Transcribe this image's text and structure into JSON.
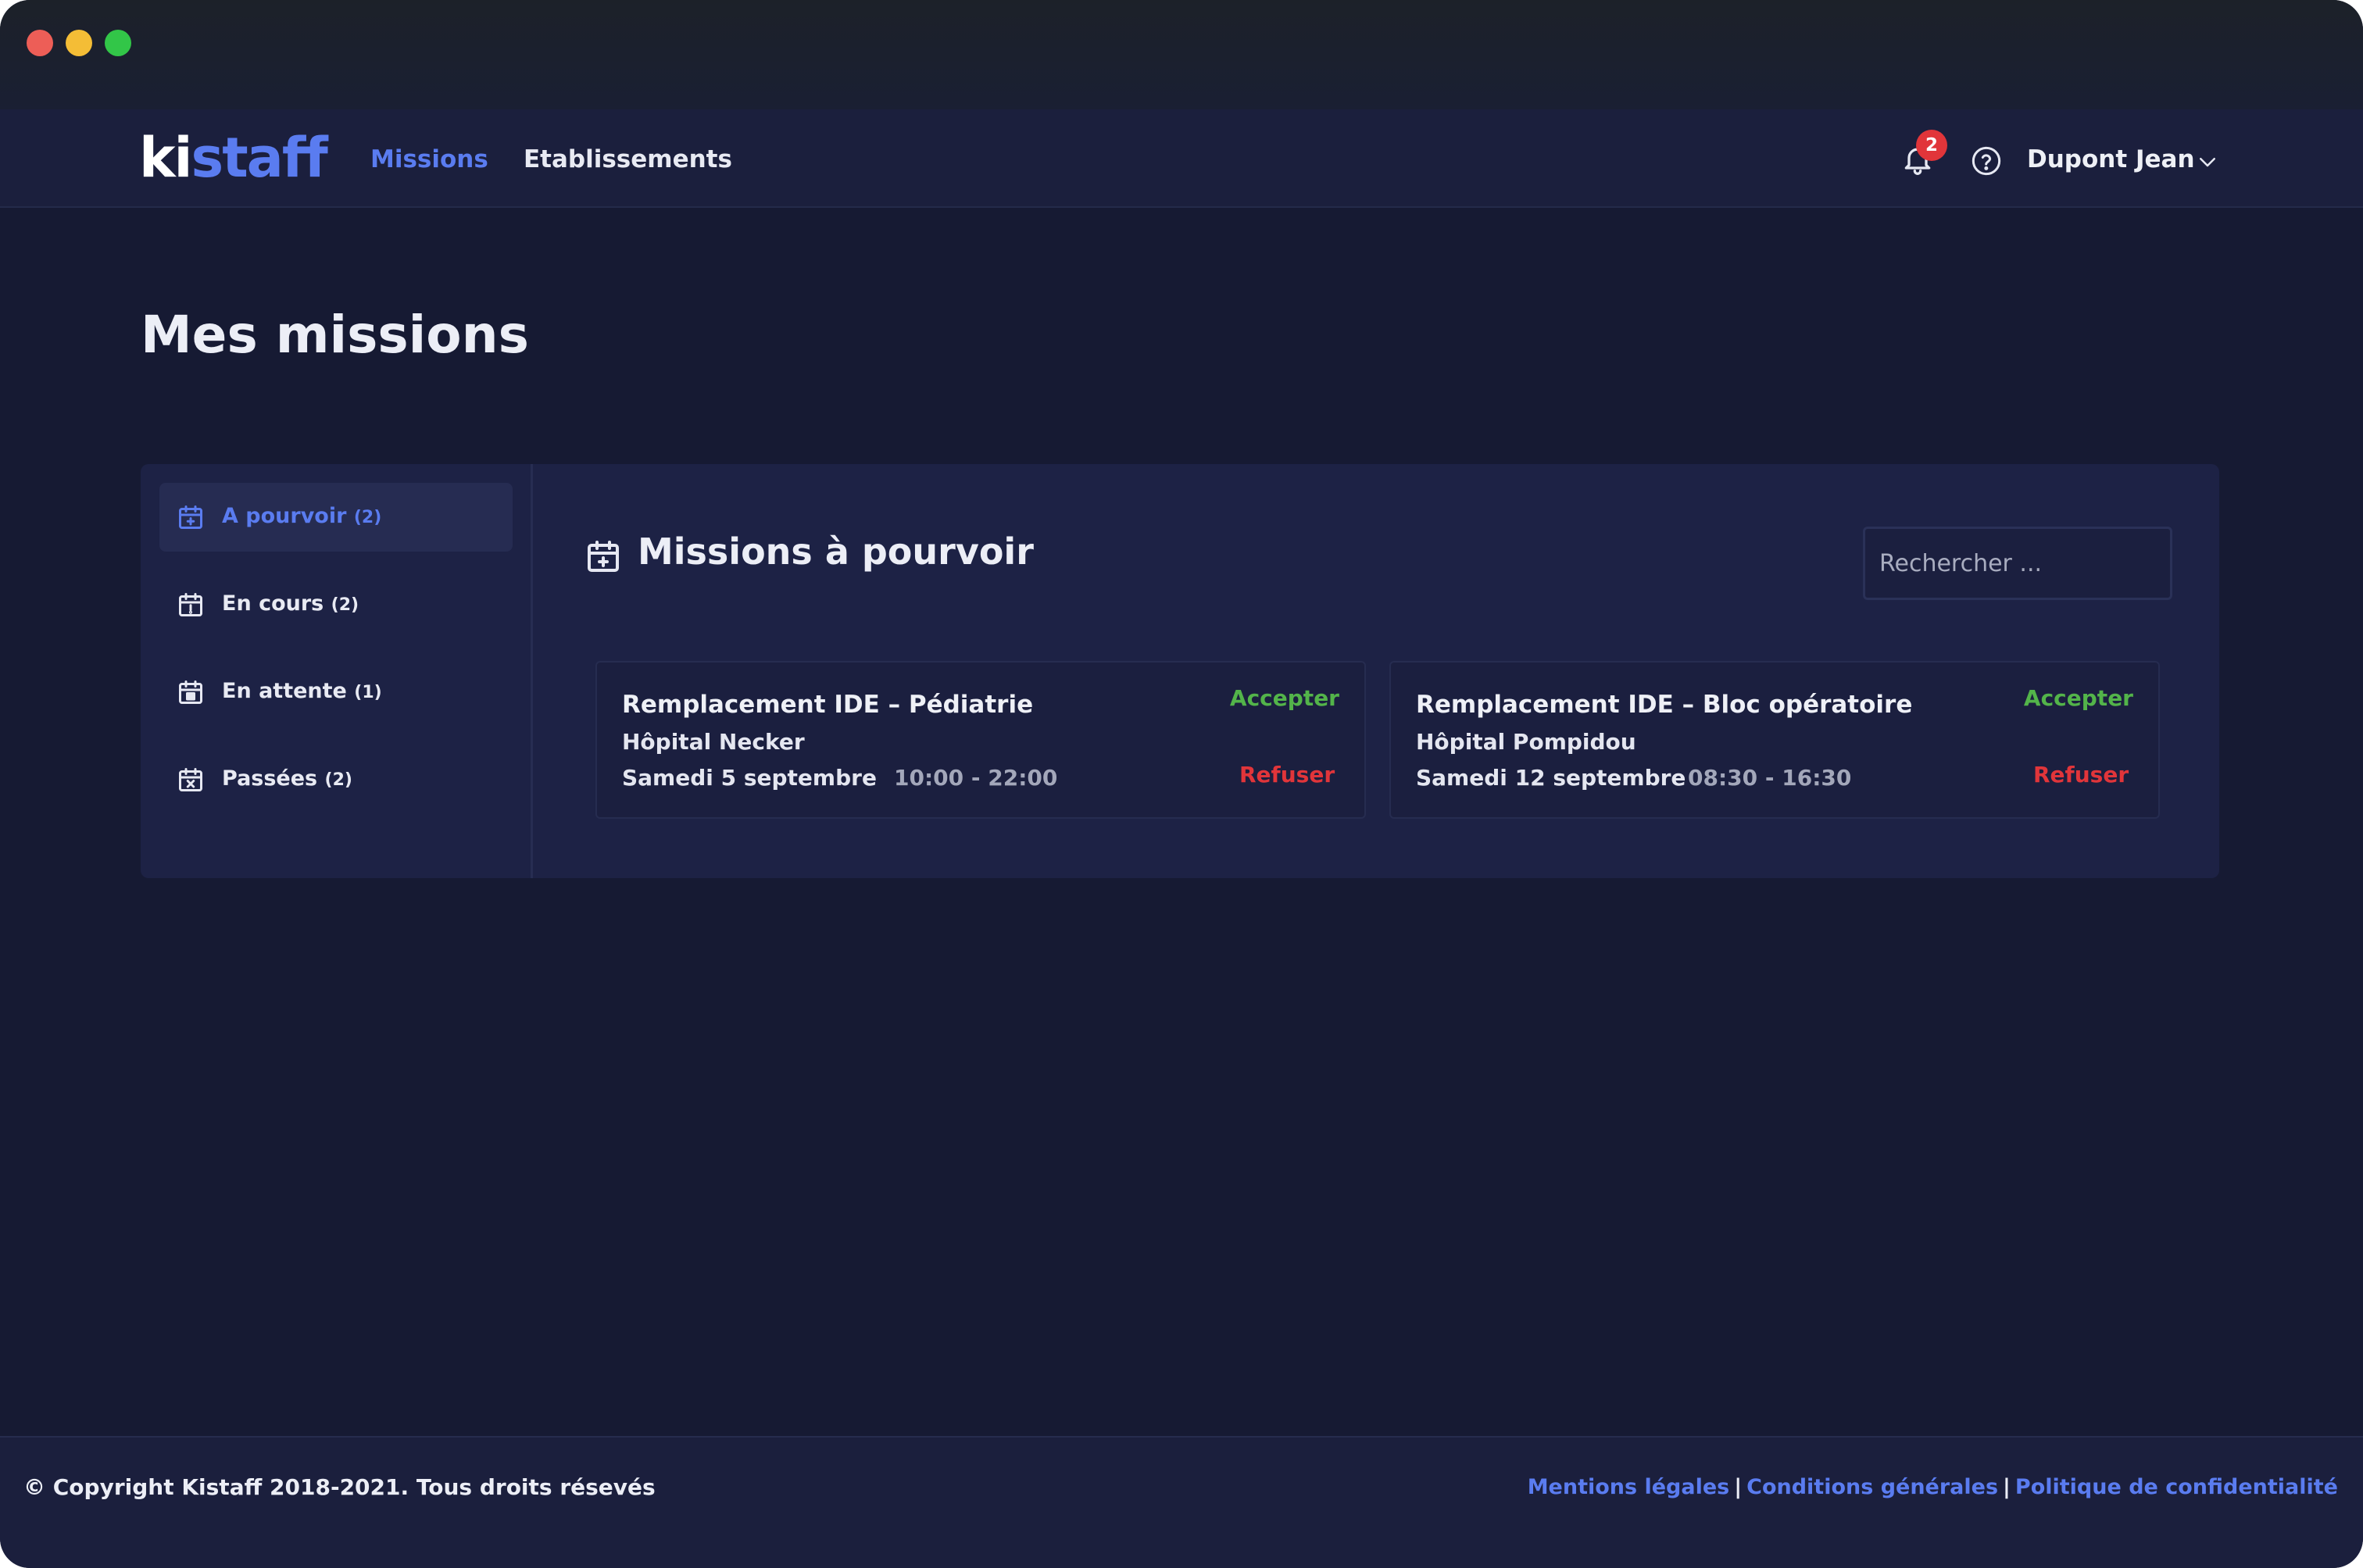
{
  "brand": {
    "logo_part1": "ki",
    "logo_part2": "staff",
    "accent_color": "#5a7cf0"
  },
  "nav": {
    "items": [
      {
        "label": "Missions",
        "active": true
      },
      {
        "label": "Etablissements",
        "active": false
      }
    ]
  },
  "header": {
    "notification_icon": "bell-icon",
    "notification_count": "2",
    "help_icon": "help-circle-icon",
    "user_name": "Dupont Jean",
    "user_menu_icon": "chevron-down-icon"
  },
  "page": {
    "title": "Mes missions"
  },
  "sidebar": {
    "items": [
      {
        "label": "A pourvoir",
        "count": "(2)",
        "icon": "calendar-plus-icon",
        "active": true
      },
      {
        "label": "En cours",
        "count": "(2)",
        "icon": "calendar-alert-icon",
        "active": false
      },
      {
        "label": "En attente",
        "count": "(1)",
        "icon": "calendar-icon",
        "active": false
      },
      {
        "label": "Passées",
        "count": "(2)",
        "icon": "calendar-x-icon",
        "active": false
      }
    ]
  },
  "content": {
    "title": "Missions à pourvoir",
    "title_icon": "calendar-plus-icon",
    "search_placeholder": "Rechercher ...",
    "missions": [
      {
        "title": "Remplacement IDE – Pédiatrie",
        "place": "Hôpital Necker",
        "date": "Samedi 5 septembre",
        "time": "10:00 - 22:00",
        "accept_label": "Accepter",
        "refuse_label": "Refuser"
      },
      {
        "title": "Remplacement IDE – Bloc opératoire",
        "place": "Hôpital Pompidou",
        "date": "Samedi 12 septembre",
        "time": "08:30 - 16:30",
        "accept_label": "Accepter",
        "refuse_label": "Refuser"
      }
    ]
  },
  "footer": {
    "copyright": "© Copyright Kistaff 2018-2021. Tous droits résevés",
    "links": [
      "Mentions légales",
      "Conditions générales",
      "Politique de confidentialité"
    ],
    "separator": "|"
  },
  "colors": {
    "accept": "#53b44a",
    "refuse": "#e1353a",
    "background": "#161a33"
  }
}
